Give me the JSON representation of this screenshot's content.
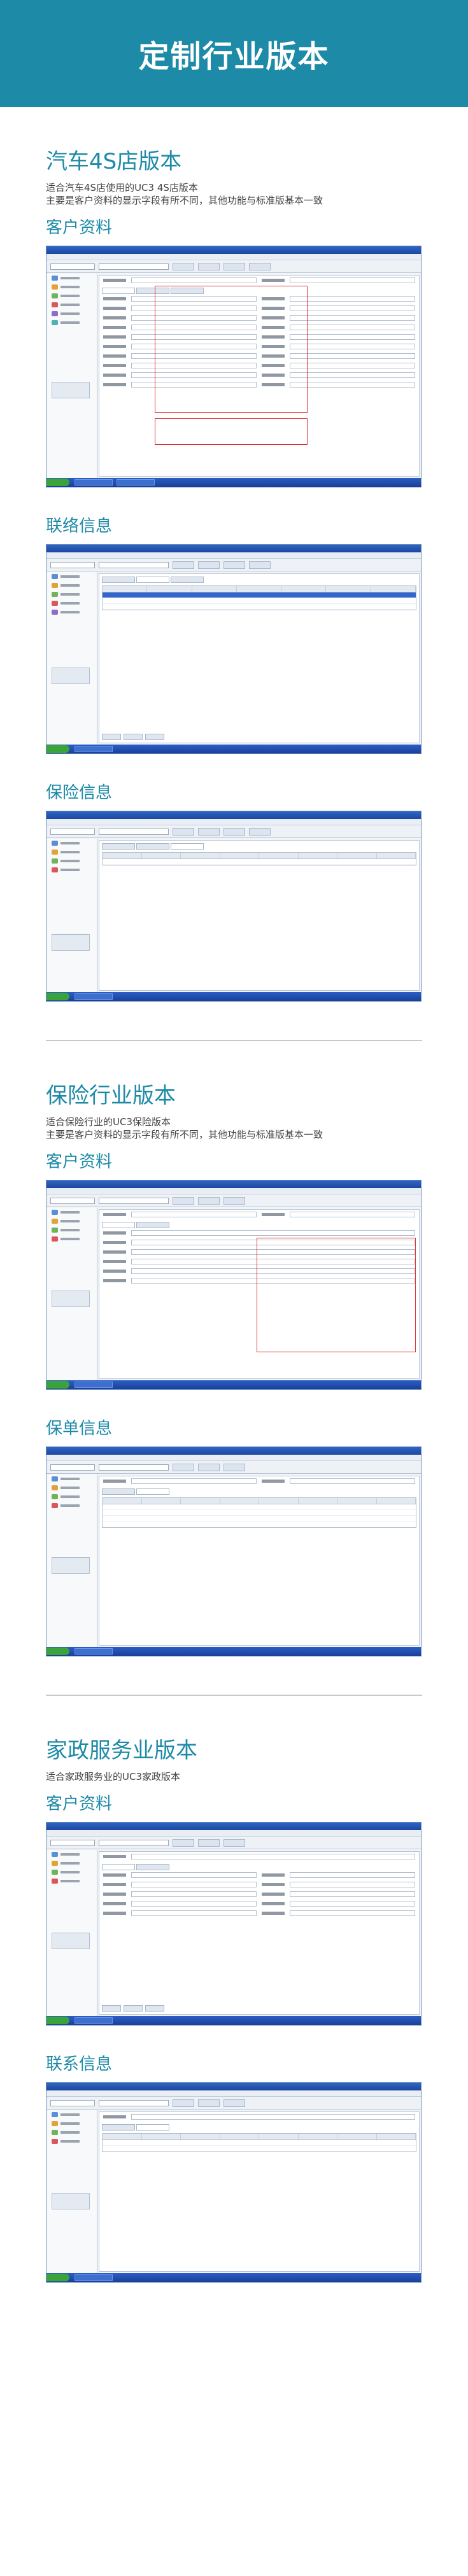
{
  "banner": {
    "title": "定制行业版本"
  },
  "auto": {
    "title": "汽车4S店版本",
    "desc1": "适合汽车4S店使用的UC3 4S店版本",
    "desc2": "主要是客户资料的显示字段有所不同，其他功能与标准版基本一致",
    "sub_customer": "客户资料",
    "sub_contact": "联络信息",
    "sub_insurance": "保险信息"
  },
  "insurance": {
    "title": "保险行业版本",
    "desc1": "适合保险行业的UC3保险版本",
    "desc2": "主要是客户资料的显示字段有所不同，其他功能与标准版基本一致",
    "sub_customer": "客户资料",
    "sub_policy": "保单信息"
  },
  "home": {
    "title": "家政服务业版本",
    "desc1": "适合家政服务业的UC3家政版本",
    "sub_customer": "客户资料",
    "sub_contact": "联系信息"
  },
  "colors": {
    "accent": "#1d8aa7",
    "highlight": "#e03030",
    "window_title": "#2f66c3"
  }
}
